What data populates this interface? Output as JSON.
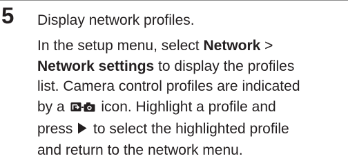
{
  "step": {
    "number": "5",
    "heading": "Display network profiles.",
    "body": {
      "line1_prefix": "In the setup menu, select ",
      "menu_network": "Network",
      "separator": " >",
      "menu_network_settings": "Network settings",
      "line2_suffix": " to display the profiles",
      "line3": "list. Camera control profiles are indicated",
      "line4_prefix": "by a ",
      "line4_suffix": " icon. Highlight a profile and",
      "line5_prefix": "press ",
      "line5_suffix": " to select the highlighted profile",
      "line6": "and return to the network menu."
    },
    "icons": {
      "profile_icon": "camera-control-profile-icon",
      "arrow_icon": "right-arrow-icon"
    }
  }
}
